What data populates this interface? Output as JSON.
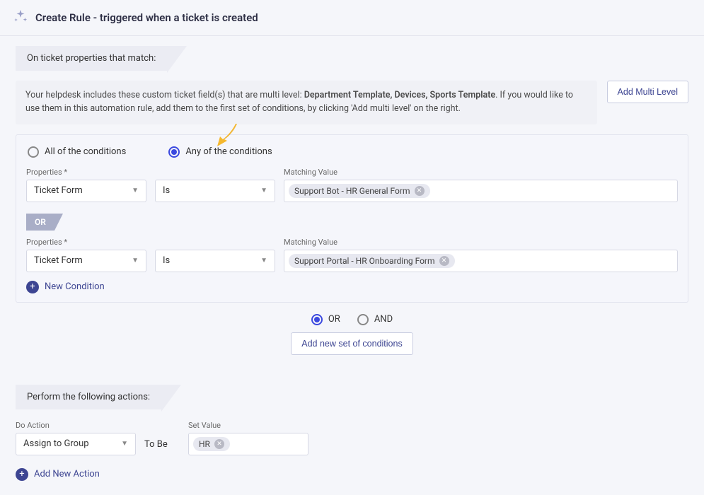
{
  "header": {
    "title": "Create Rule - triggered when a ticket is created"
  },
  "section_props": {
    "heading": "On ticket properties that match:"
  },
  "info": {
    "prefix": "Your helpdesk includes these custom ticket field(s) that are multi level: ",
    "bold_fields": "Department Template, Devices, Sports Template",
    "suffix": ". If you would like to use them in this automation rule, add them to the first set of conditions, by clicking 'Add multi level' on the right.",
    "add_multi_level_btn": "Add Multi Level"
  },
  "cond_type": {
    "all": "All of the conditions",
    "any": "Any of the conditions"
  },
  "labels": {
    "properties": "Properties *",
    "matching_value": "Matching Value",
    "do_action": "Do Action",
    "set_value": "Set Value"
  },
  "conditions": {
    "rows": [
      {
        "property": "Ticket Form",
        "op": "Is",
        "value": "Support Bot - HR General Form"
      },
      {
        "property": "Ticket Form",
        "op": "Is",
        "value": "Support Portal - HR Onboarding Form"
      }
    ],
    "or_badge": "OR",
    "new_condition": "New Condition"
  },
  "set_logic": {
    "or": "OR",
    "and": "AND"
  },
  "add_new_set_btn": "Add new set of conditions",
  "actions_section": {
    "heading": "Perform the following actions:"
  },
  "action_row": {
    "action": "Assign to Group",
    "to_be": "To Be",
    "value": "HR"
  },
  "add_new_action": "Add New Action"
}
